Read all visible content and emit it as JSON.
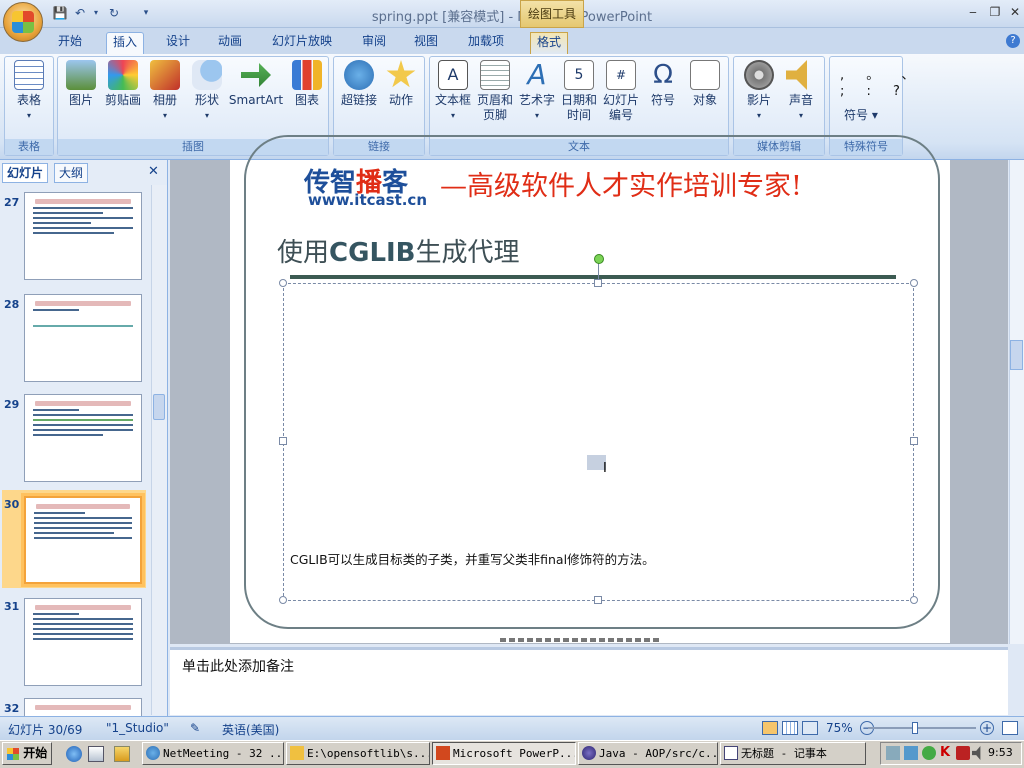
{
  "window": {
    "title": "spring.ppt [兼容模式] - Microsoft PowerPoint",
    "contextual_tab_group": "绘图工具"
  },
  "ribbon_tabs": [
    "开始",
    "插入",
    "设计",
    "动画",
    "幻灯片放映",
    "审阅",
    "视图",
    "加载项",
    "格式"
  ],
  "active_tab": "插入",
  "ribbon_groups": {
    "tables": {
      "label": "表格",
      "buttons": [
        "表格"
      ]
    },
    "illustrations": {
      "label": "插图",
      "buttons": [
        "图片",
        "剪贴画",
        "相册",
        "形状",
        "SmartArt",
        "图表"
      ]
    },
    "links": {
      "label": "链接",
      "buttons": [
        "超链接",
        "动作"
      ]
    },
    "text": {
      "label": "文本",
      "buttons": [
        "文本框",
        "页眉和\n页脚",
        "艺术字",
        "日期和\n时间",
        "幻灯片\n编号",
        "符号",
        "对象"
      ]
    },
    "media": {
      "label": "媒体剪辑",
      "buttons": [
        "影片",
        "声音"
      ]
    },
    "special_symbols": {
      "label": "特殊符号",
      "symbol_row1": ", 。 、",
      "symbol_row2": "; : ?",
      "symbol_button": "符号"
    }
  },
  "left_pane": {
    "tabs": [
      "幻灯片",
      "大纲"
    ],
    "close_glyph": "✕",
    "slide_numbers": [
      "27",
      "28",
      "29",
      "30",
      "31",
      "32"
    ],
    "selected_slide": "30"
  },
  "slide": {
    "logo_prefix": "传智",
    "logo_highlight": "播",
    "logo_suffix": "客",
    "logo_url": "www.itcast.cn",
    "slogan": "—高级软件人才实作培训专家!",
    "title_prefix": "使用",
    "title_bold": "CGLIB",
    "title_suffix": "生成代理",
    "summary": "CGLIB可以生成目标类的子类，并重写父类非final修饰符的方法。"
  },
  "notes": {
    "placeholder": "单击此处添加备注"
  },
  "status_bar": {
    "slide_counter": "幻灯片 30/69",
    "theme": "\"1_Studio\"",
    "language": "英语(美国)",
    "zoom": "75%"
  },
  "taskbar": {
    "start_label": "开始",
    "tasks": [
      "NetMeeting - 32 ...",
      "E:\\opensoftlib\\s...",
      "Microsoft PowerP...",
      "Java - AOP/src/c...",
      "无标题 - 记事本"
    ],
    "active_task": "Microsoft PowerP...",
    "clock": "9:53"
  },
  "colors": {
    "accent_red": "#e02d16",
    "accent_blue": "#1e4f9a",
    "selected_thumb": "#f3a33b",
    "ribbon_text": "#15428b"
  }
}
